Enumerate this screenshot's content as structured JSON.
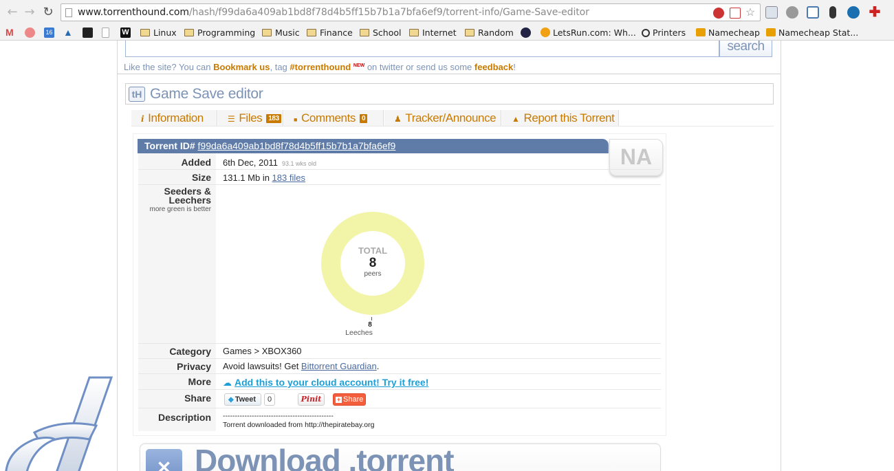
{
  "browser": {
    "url_host": "www.torrenthound.com",
    "url_rest": "/hash/f99da6a409ab1bd8f78d4b5ff15b7b1a7bfa6ef9/torrent-info/Game-Save-editor",
    "bookmarks": [
      "Linux",
      "Programming",
      "Music",
      "Finance",
      "School",
      "Internet",
      "Random",
      "LetsRun.com: Wh...",
      "Printers",
      "Namecheap",
      "Namecheap Stat..."
    ]
  },
  "header": {
    "search_label": "search",
    "like_prefix": "Like the site? You can ",
    "bookmark_us": "Bookmark us",
    "tag_text": ", tag ",
    "hashtag": "#torrenthound",
    "new_badge": "NEW",
    "twitter_text": " on twitter or send us some ",
    "feedback": "feedback",
    "bang": "!"
  },
  "torrent": {
    "logo": "tH",
    "title": "Game Save editor",
    "tabs": [
      {
        "icon": "info-icon",
        "glyph": "i",
        "label": "Information"
      },
      {
        "icon": "list-icon",
        "glyph": "☰",
        "label": "Files",
        "badge": "183"
      },
      {
        "icon": "comment-icon",
        "glyph": "■",
        "label": "Comments",
        "badge": "0"
      },
      {
        "icon": "users-icon",
        "glyph": "♟",
        "label": "Tracker/Announce"
      },
      {
        "icon": "warning-icon",
        "glyph": "▲",
        "label": "Report this Torrent"
      }
    ],
    "id_label": "Torrent ID#",
    "id_hash": "f99da6a409ab1bd8f78d4b5ff15b7b1a7bfa6ef9",
    "rating_badge": "NA",
    "added_label": "Added",
    "added_value": "6th Dec, 2011",
    "added_ago": "93.1 wks old",
    "size_label": "Size",
    "size_value": "131.1 Mb in ",
    "size_files": "183 files",
    "seeders_label_1": "Seeders &",
    "seeders_label_2": "Leechers",
    "seeders_sub": "more green is better",
    "donut_total_label": "TOTAL",
    "donut_total": "8",
    "donut_unit": "peers",
    "leechers_count": "8",
    "leechers_label": "Leeches",
    "category_label": "Category",
    "category_value": "Games > XBOX360",
    "privacy_label": "Privacy",
    "privacy_prefix": "Avoid lawsuits! Get ",
    "privacy_link": "Bittorrent Guardian",
    "privacy_suffix": ".",
    "more_label": "More",
    "more_link": "Add this to your cloud account! Try it free!",
    "share_label": "Share",
    "tweet_label": "Tweet",
    "tweet_count": "0",
    "pinit_label": "Pinit",
    "share_btn_label": "Share",
    "description_label": "Description",
    "description_line1": "----------------------------------------------",
    "description_line2": "Torrent downloaded from http://thepiratebay.org",
    "download_label": "Download .torrent"
  },
  "chart_data": {
    "type": "pie",
    "categories": [
      "Seeders",
      "Leechers"
    ],
    "values": [
      0,
      8
    ],
    "colors": {
      "leechers": "#f2f5a8"
    }
  },
  "colors": {
    "accent_blue": "#7d93b6",
    "id_bar": "#5f7ca8",
    "orange": "#c87a00"
  }
}
